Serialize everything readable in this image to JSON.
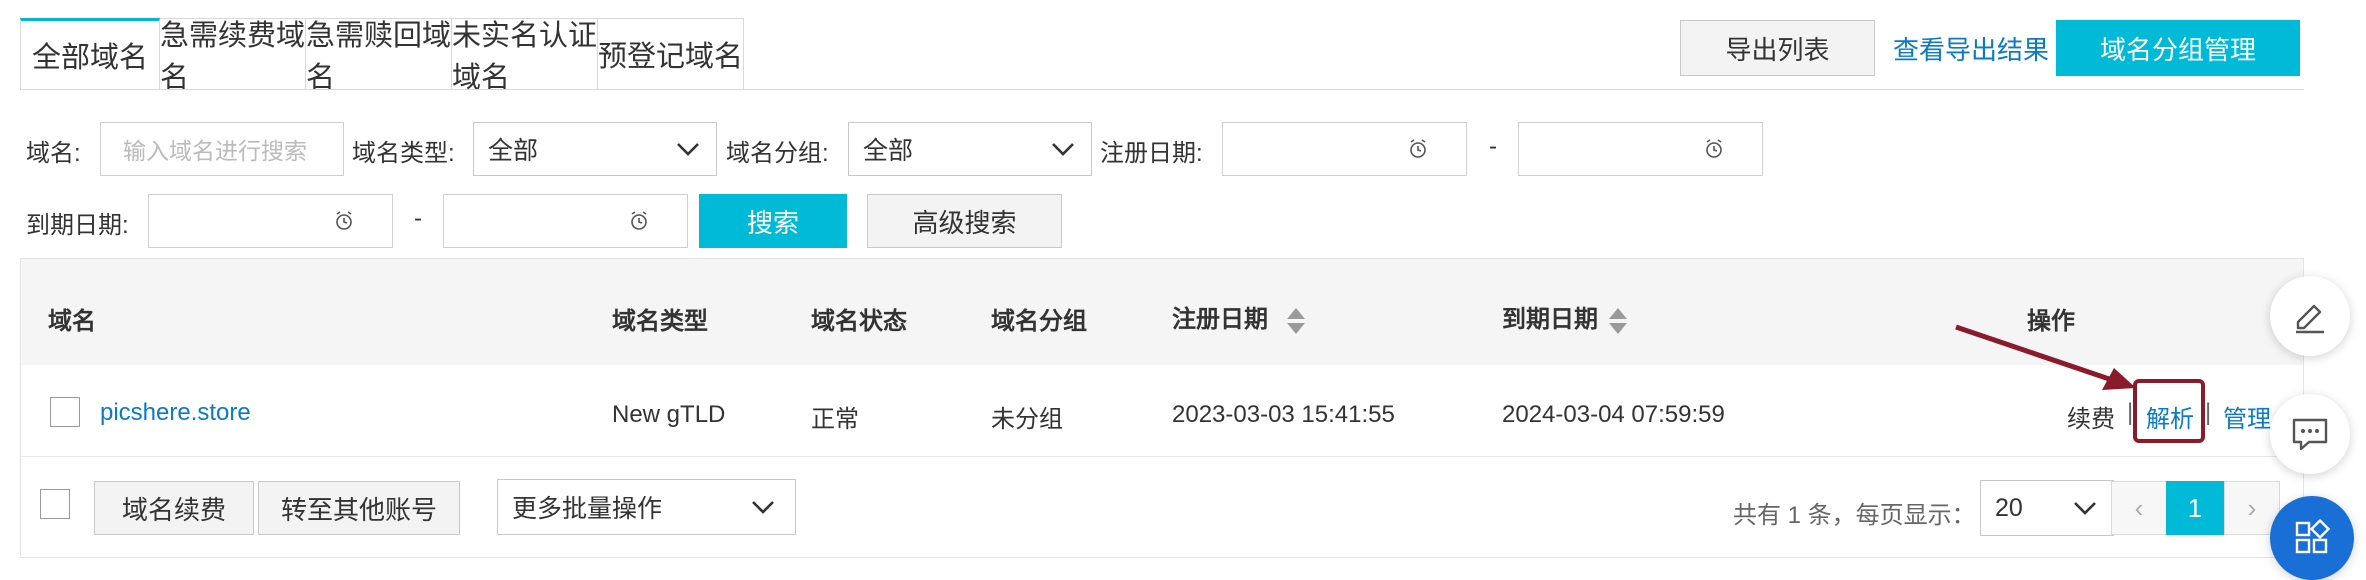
{
  "tabs": [
    {
      "label": "全部域名",
      "active": true
    },
    {
      "label": "急需续费域名",
      "active": false
    },
    {
      "label": "急需赎回域名",
      "active": false
    },
    {
      "label": "未实名认证域名",
      "active": false
    },
    {
      "label": "预登记域名",
      "active": false
    }
  ],
  "toolbar": {
    "export_list": "导出列表",
    "view_export_results": "查看导出结果",
    "group_management": "域名分组管理"
  },
  "filters": {
    "domain_label": "域名:",
    "domain_placeholder": "输入域名进行搜索",
    "type_label": "域名类型:",
    "type_value": "全部",
    "group_label": "域名分组:",
    "group_value": "全部",
    "reg_date_label": "注册日期:",
    "range_sep": "-",
    "exp_date_label": "到期日期:",
    "search_button": "搜索",
    "advanced_search_button": "高级搜索"
  },
  "table": {
    "columns": {
      "domain": "域名",
      "type": "域名类型",
      "status": "域名状态",
      "group": "域名分组",
      "reg_date": "注册日期",
      "exp_date": "到期日期",
      "actions": "操作"
    },
    "rows": [
      {
        "domain": "picshere.store",
        "type": "New gTLD",
        "status": "正常",
        "group": "未分组",
        "reg_date": "2023-03-03 15:41:55",
        "exp_date": "2024-03-04 07:59:59",
        "actions": {
          "renew": "续费",
          "resolve": "解析",
          "manage": "管理",
          "sep": "|"
        }
      }
    ]
  },
  "bulk": {
    "renew_button": "域名续费",
    "transfer_button": "转至其他账号",
    "more_ops": "更多批量操作"
  },
  "pagination": {
    "summary": "共有 1 条，每页显示：",
    "page_size": "20",
    "prev": "‹",
    "current_page": "1",
    "next": "›"
  },
  "colors": {
    "accent": "#00bad8",
    "link": "#0a7ac9",
    "highlight_box": "#8b1a2b",
    "fab_blue": "#1a6fd6"
  },
  "icons": [
    "chevron-down-icon",
    "clock-icon",
    "sort-icon",
    "edit-icon",
    "chat-icon",
    "apps-icon"
  ]
}
